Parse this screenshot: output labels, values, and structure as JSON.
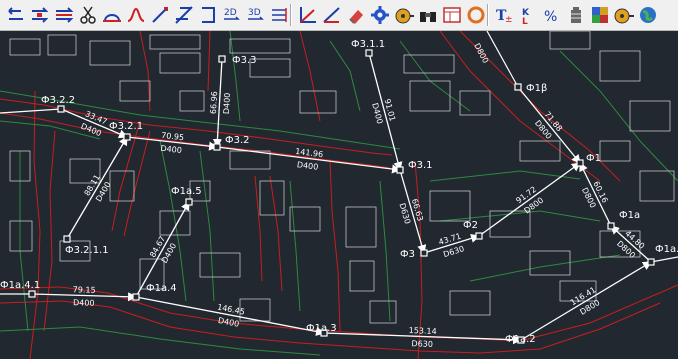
{
  "toolbar": {
    "tools": [
      {
        "name": "undo-arrow-icon"
      },
      {
        "name": "insert-node-icon"
      },
      {
        "name": "split-line-icon"
      },
      {
        "name": "cut-icon"
      },
      {
        "name": "arc-line-icon"
      },
      {
        "name": "smooth-line-icon"
      },
      {
        "name": "draw-pipe-icon"
      },
      {
        "name": "cross-line-icon"
      },
      {
        "name": "bracket-icon"
      },
      {
        "name": "label-2d-icon"
      },
      {
        "name": "label-3d-icon"
      },
      {
        "name": "merge-lines-icon"
      },
      {
        "name": "axes-icon"
      },
      {
        "name": "slope-icon"
      },
      {
        "name": "eraser-icon"
      },
      {
        "name": "gear-icon"
      },
      {
        "name": "measure-tape-icon"
      },
      {
        "name": "binoculars-icon"
      },
      {
        "name": "table-window-icon"
      },
      {
        "name": "ring-icon"
      },
      {
        "name": "text-style-icon"
      },
      {
        "name": "vertical-text-icon"
      },
      {
        "name": "percent-icon"
      },
      {
        "name": "manhole-icon"
      },
      {
        "name": "palette-icon"
      },
      {
        "name": "tape-measure-icon"
      },
      {
        "name": "globe-icon"
      }
    ]
  },
  "nodes": [
    {
      "id": "n_f322",
      "label": "Ф3.2.2"
    },
    {
      "id": "n_f321",
      "label": "Ф3.2.1"
    },
    {
      "id": "n_f3211",
      "label": "Ф3.2.1.1"
    },
    {
      "id": "n_f33",
      "label": "Ф3.3"
    },
    {
      "id": "n_f32",
      "label": "Ф3.2"
    },
    {
      "id": "n_f311",
      "label": "Ф3.1.1"
    },
    {
      "id": "n_f31",
      "label": "Ф3.1"
    },
    {
      "id": "n_f3",
      "label": "Ф3"
    },
    {
      "id": "n_f2",
      "label": "Ф2"
    },
    {
      "id": "n_f1b",
      "label": "Ф1β"
    },
    {
      "id": "n_f1",
      "label": "Ф1"
    },
    {
      "id": "n_f1a",
      "label": "Ф1а"
    },
    {
      "id": "n_f1aa",
      "label": "Ф1а."
    },
    {
      "id": "n_f1a2",
      "label": "Ф1а.2"
    },
    {
      "id": "n_f1a3",
      "label": "Ф1а.3"
    },
    {
      "id": "n_f1a4",
      "label": "Ф1а.4"
    },
    {
      "id": "n_f1a41",
      "label": "Ф1а.4.1"
    },
    {
      "id": "n_f1a5",
      "label": "Ф1а.5"
    }
  ],
  "segments": [
    {
      "length": "33.47",
      "diameter": "D400"
    },
    {
      "length": "70.95",
      "diameter": "D400"
    },
    {
      "length": "66.96",
      "diameter": "D400"
    },
    {
      "length": "141.96",
      "diameter": "D400"
    },
    {
      "length": "91.01",
      "diameter": "D400"
    },
    {
      "length": "66.63",
      "diameter": "D630"
    },
    {
      "length": "43.71",
      "diameter": "D630"
    },
    {
      "length": "91.72",
      "diameter": "D800"
    },
    {
      "length": "71.88",
      "diameter": "D800"
    },
    {
      "length": "D800",
      "diameter": ""
    },
    {
      "length": "60.16",
      "diameter": "D800"
    },
    {
      "length": "44.80",
      "diameter": "D800"
    },
    {
      "length": "116.41",
      "diameter": "D800"
    },
    {
      "length": "153.14",
      "diameter": "D630"
    },
    {
      "length": "146.45",
      "diameter": "D400"
    },
    {
      "length": "79.15",
      "diameter": "D400"
    },
    {
      "length": "84.67",
      "diameter": "D400"
    },
    {
      "length": "88.11",
      "diameter": "D400"
    }
  ],
  "colors": {
    "background": "#212830",
    "building_outline": "#c8c8c8",
    "road_red": "#c81e1e",
    "parcel_green": "#2e8a3e",
    "pipe": "#ffffff"
  }
}
